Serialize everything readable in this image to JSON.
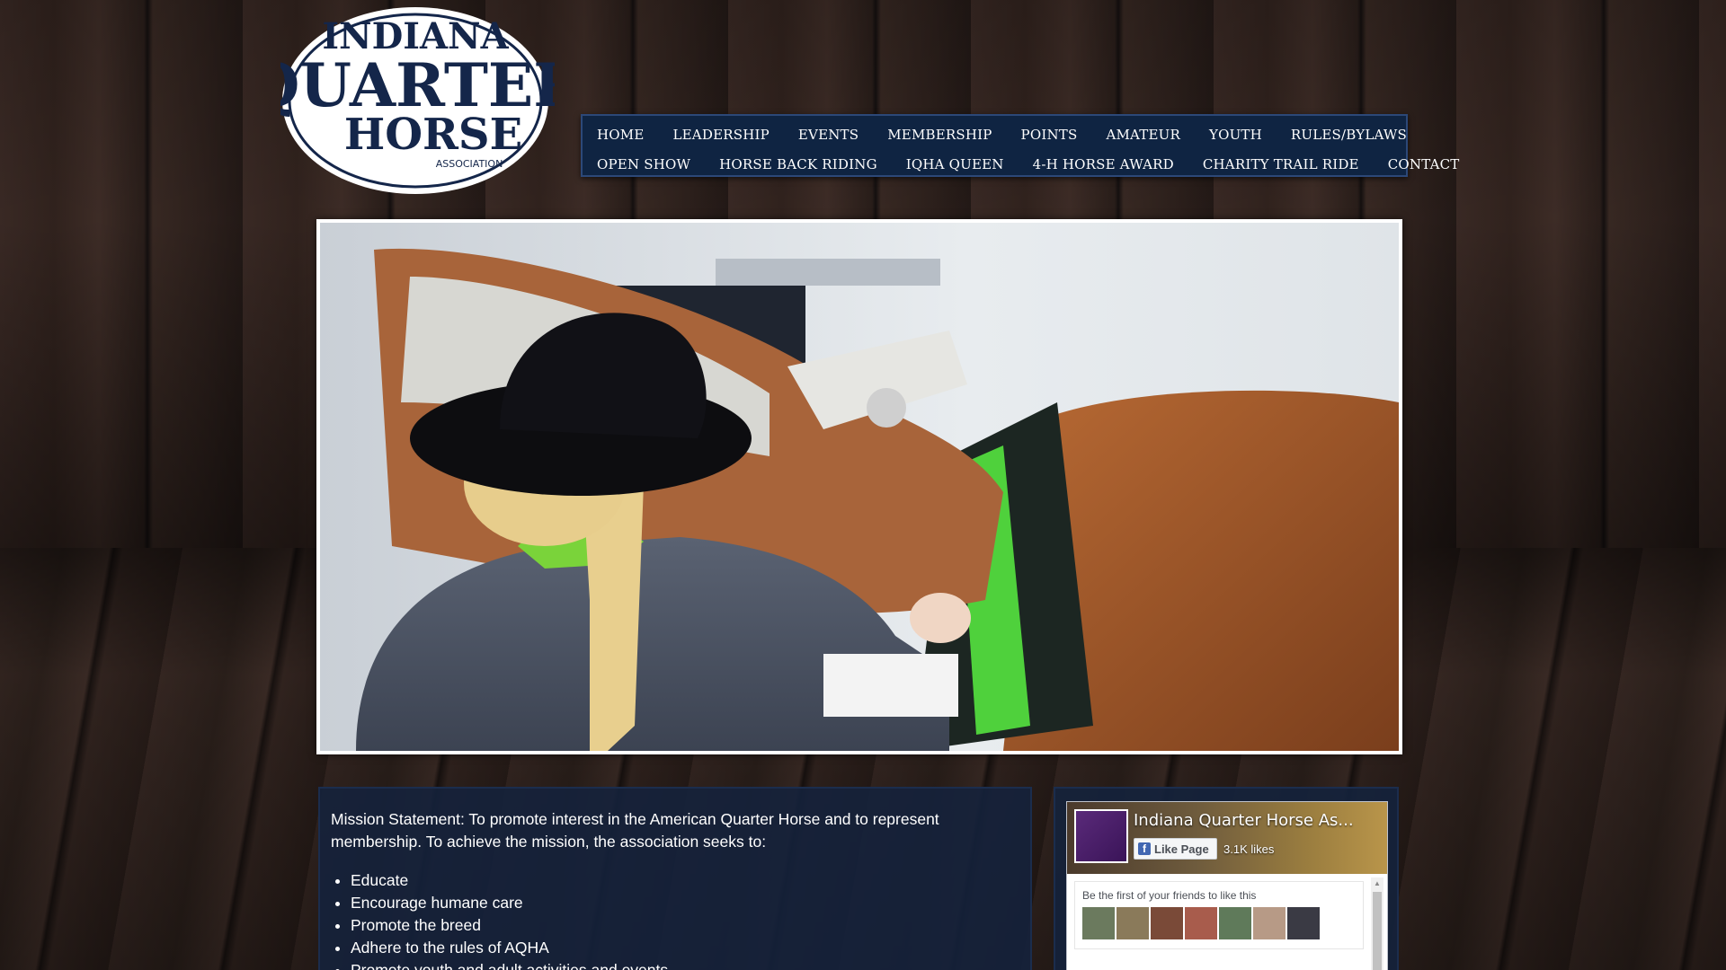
{
  "logo": {
    "line1": "INDIANA",
    "line2": "QUARTER",
    "line3": "HORSE",
    "line4": "ASSOCIATION"
  },
  "nav": {
    "row1": [
      "HOME",
      "LEADERSHIP",
      "EVENTS",
      "MEMBERSHIP",
      "POINTS",
      "AMATEUR",
      "YOUTH",
      "RULES/BYLAWS"
    ],
    "row2": [
      "OPEN SHOW",
      "HORSE BACK RIDING",
      "IQHA QUEEN",
      "4-H HORSE AWARD",
      "CHARITY TRAIL RIDE",
      "CONTACT"
    ]
  },
  "mission": {
    "statement": "Mission Statement: To promote interest in the American Quarter Horse and to represent membership. To achieve the mission, the association seeks to:",
    "items": [
      "Educate",
      "Encourage humane care",
      "Promote the breed",
      "Adhere to the rules of AQHA",
      "Promote youth and adult activities and events"
    ]
  },
  "facebook": {
    "page_name": "Indiana Quarter Horse As...",
    "like_label": "Like Page",
    "likes": "3.1K likes",
    "friends_text": "Be the first of your friends to like this",
    "brand_color": "#4267b2"
  },
  "colors": {
    "nav_bg": "#0f2442",
    "panel_bg": "#14223c",
    "logo_navy": "#14264a"
  }
}
